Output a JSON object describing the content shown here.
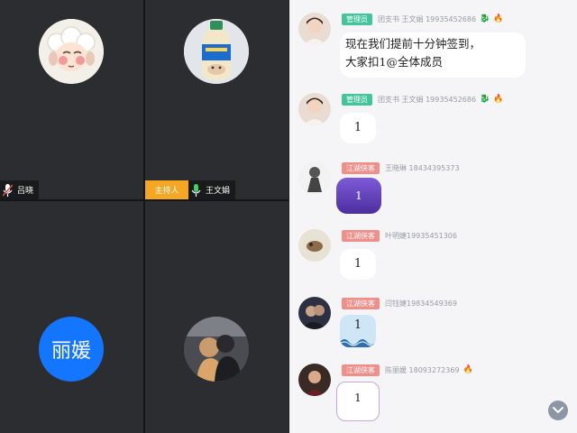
{
  "participants": [
    {
      "name": "吕晓",
      "avatar": "sheep-avatar",
      "mic": "muted"
    },
    {
      "name": "王文娟",
      "avatar": "drink-bottle-avatar",
      "mic": "on",
      "role_tag": "主持人"
    },
    {
      "name": "",
      "avatar_text": "丽媛",
      "mic": ""
    },
    {
      "name": "",
      "avatar": "couple-photo-avatar",
      "mic": ""
    }
  ],
  "messages": [
    {
      "role": "管理员",
      "sender": "团支书 王文娟 19935452686",
      "badges": [
        "🐉",
        "🔥"
      ],
      "text": "现在我们提前十分钟签到，\n大家扣1@全体成员"
    },
    {
      "role": "管理员",
      "sender": "团支书 王文娟 19935452686",
      "badges": [
        "🐉",
        "🔥"
      ],
      "text": "1"
    },
    {
      "role": "江湖侠客",
      "sender": "王晓琳 18434395373",
      "badges": [],
      "text": "1"
    },
    {
      "role": "江湖侠客",
      "sender": "叶明婕19935451306",
      "badges": [],
      "text": "1"
    },
    {
      "role": "江湖侠客",
      "sender": "闫钰婕19834549369",
      "badges": [],
      "text": "1"
    },
    {
      "role": "江湖侠客",
      "sender": "陈丽媛 18093272369",
      "badges": [
        "🔥"
      ],
      "text": "1"
    }
  ],
  "colors": {
    "host_tag": "#f5a623",
    "admin_tag": "#43c49a",
    "member_tag": "#f08e8a",
    "name_avatar": "#1476ff"
  }
}
